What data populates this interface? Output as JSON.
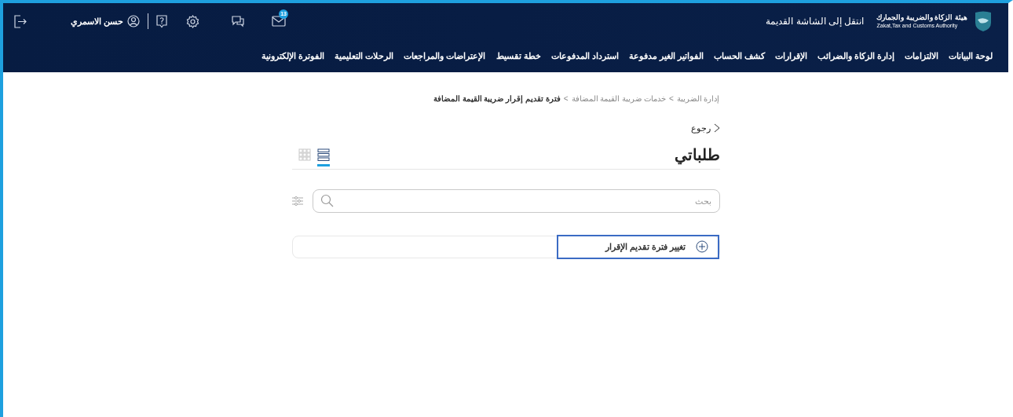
{
  "header": {
    "logo": {
      "name_ar": "هيئة الزكاة والضريبة والجمارك",
      "name_en": "Zakat,Tax and Customs Authority"
    },
    "old_screen_link": "انتقل إلى الشاشة القديمة",
    "toolbar": [
      {
        "kind": "mail",
        "badge": "13"
      },
      {
        "kind": "chat"
      },
      {
        "kind": "settings"
      },
      {
        "kind": "help"
      },
      {
        "kind": "divider"
      },
      {
        "kind": "user",
        "label": "حسن الاسمري"
      },
      {
        "kind": "logout"
      }
    ],
    "nav": [
      "لوحة البيانات",
      "الالتزامات",
      "إدارة الزكاة والضرائب",
      "الإقرارات",
      "كشف الحساب",
      "الفواتير الغير مدفوعة",
      "استرداد المدفوعات",
      "خطة تقسيط",
      "الإعتراضات والمراجعات",
      "الرحلات التعليمية",
      "الفوترة الإلكترونية"
    ]
  },
  "breadcrumb": [
    {
      "kind": "link",
      "label": "إدارة الضريبة"
    },
    {
      "kind": "separator",
      "label": ">"
    },
    {
      "kind": "link",
      "label": "خدمات ضريبة القيمة المضافة"
    },
    {
      "kind": "separator",
      "label": ">"
    },
    {
      "kind": "current",
      "label": "فترة تقديم إقرار ضريبة القيمة المضافة"
    }
  ],
  "back": "رجوع",
  "title": "طلباتي",
  "view_toggles": [
    {
      "kind": "list",
      "selected": true
    },
    {
      "kind": "grid",
      "selected": false
    }
  ],
  "search": {
    "placeholder": "بحث"
  },
  "actions": [
    {
      "label": "تغيير فترة تقديم الإقرار",
      "focused": true
    }
  ]
}
